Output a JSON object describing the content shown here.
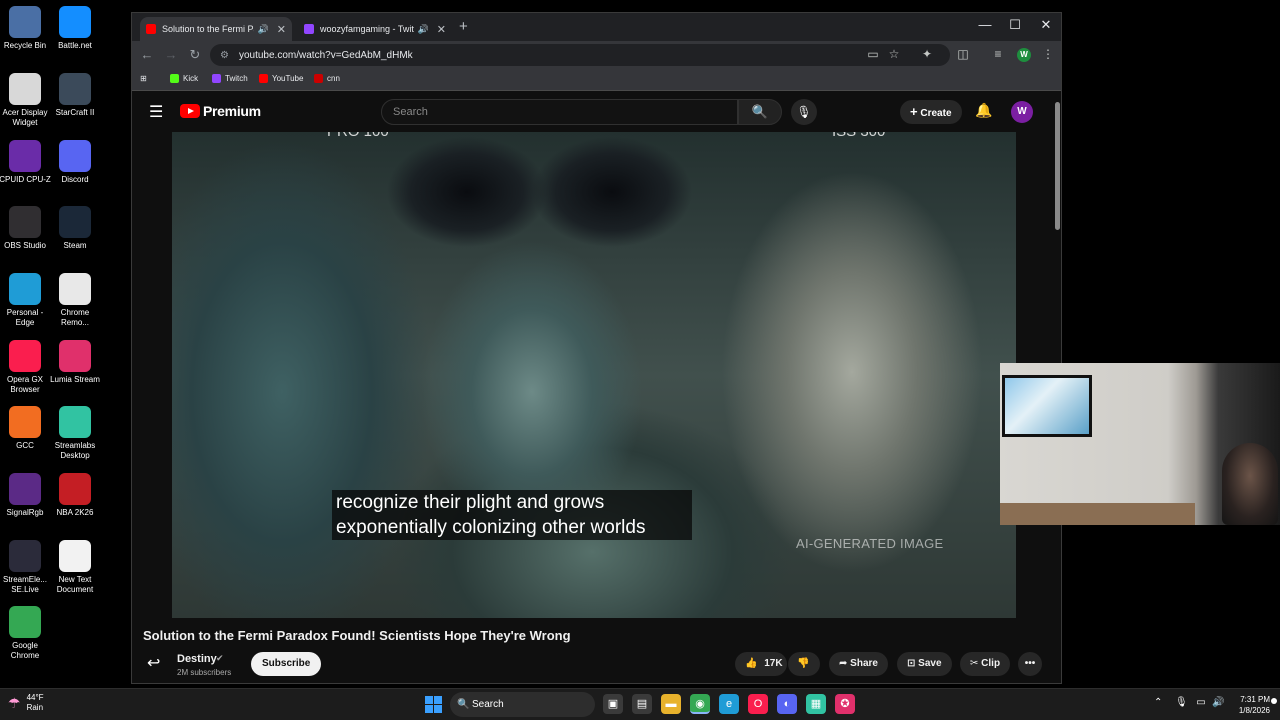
{
  "desktop": {
    "icons": [
      {
        "label": "Recycle Bin",
        "icon": "recycle-bin-icon",
        "color": "#4a6fa5"
      },
      {
        "label": "Battle.net",
        "icon": "battlenet-icon",
        "color": "#148eff"
      },
      {
        "label": "Acer Display Widget",
        "icon": "acer-display-icon",
        "color": "#d8d8d8"
      },
      {
        "label": "StarCraft II",
        "icon": "starcraft-icon",
        "color": "#3b4a5a"
      },
      {
        "label": "CPUID CPU-Z",
        "icon": "cpuz-icon",
        "color": "#6a2ca8"
      },
      {
        "label": "Discord",
        "icon": "discord-icon",
        "color": "#5865f2"
      },
      {
        "label": "OBS Studio",
        "icon": "obs-icon",
        "color": "#302e31"
      },
      {
        "label": "Steam",
        "icon": "steam-icon",
        "color": "#1b2838"
      },
      {
        "label": "Personal - Edge",
        "icon": "edge-icon",
        "color": "#1f9cd6"
      },
      {
        "label": "Chrome Remo...",
        "icon": "chrome-remote-icon",
        "color": "#e8e8e8"
      },
      {
        "label": "Opera GX Browser",
        "icon": "opera-gx-icon",
        "color": "#fa1e4e"
      },
      {
        "label": "Lumia Stream",
        "icon": "lumia-icon",
        "color": "#e0306b"
      },
      {
        "label": "GCC",
        "icon": "gcc-icon",
        "color": "#f26d21"
      },
      {
        "label": "Streamlabs Desktop",
        "icon": "streamlabs-icon",
        "color": "#31c3a2"
      },
      {
        "label": "SignalRgb",
        "icon": "signalrgb-icon",
        "color": "#5b2a86"
      },
      {
        "label": "NBA 2K26",
        "icon": "nba2k-icon",
        "color": "#c41e24"
      },
      {
        "label": "StreamEle... SE.Live",
        "icon": "streamelements-icon",
        "color": "#2b2b3a"
      },
      {
        "label": "New Text Document",
        "icon": "text-document-icon",
        "color": "#f2f2f2"
      },
      {
        "label": "Google Chrome",
        "icon": "chrome-icon",
        "color": "#34a853"
      }
    ]
  },
  "browser": {
    "tabs": [
      {
        "title": "Solution to the Fermi Parad",
        "favicon_color": "#ff0000",
        "active": true
      },
      {
        "title": "woozyfamgaming - Twitch",
        "favicon_color": "#9146ff",
        "active": false
      }
    ],
    "new_tab": "+",
    "url": "youtube.com/watch?v=GedAbM_dHMk",
    "bookmarks": [
      {
        "label": "Kick",
        "color": "#53fc18"
      },
      {
        "label": "Twitch",
        "color": "#9146ff"
      },
      {
        "label": "YouTube",
        "color": "#ff0000"
      },
      {
        "label": "cnn",
        "color": "#cc0000"
      }
    ],
    "profile_initial": "W"
  },
  "youtube": {
    "logo_text": "Premium",
    "search_placeholder": "Search",
    "create_label": "Create",
    "avatar_initial": "W",
    "video": {
      "top_partial_left": "PRO 100",
      "top_partial_right": "ISS 300",
      "caption_line1": "recognize their plight and grows",
      "caption_line2": "exponentially colonizing other worlds",
      "watermark": "AI-GENERATED IMAGE"
    },
    "title": "Solution to the Fermi Paradox Found! Scientists Hope They're Wrong",
    "channel": "Destiny",
    "subscribers": "2M subscribers",
    "subscribe_label": "Subscribe",
    "likes": "17K",
    "share_label": "Share",
    "save_label": "Save",
    "clip_label": "Clip"
  },
  "taskbar": {
    "weather_temp": "44°F",
    "weather_cond": "Rain",
    "search_label": "Search",
    "time": "7:31 PM",
    "date": "1/8/2026"
  }
}
